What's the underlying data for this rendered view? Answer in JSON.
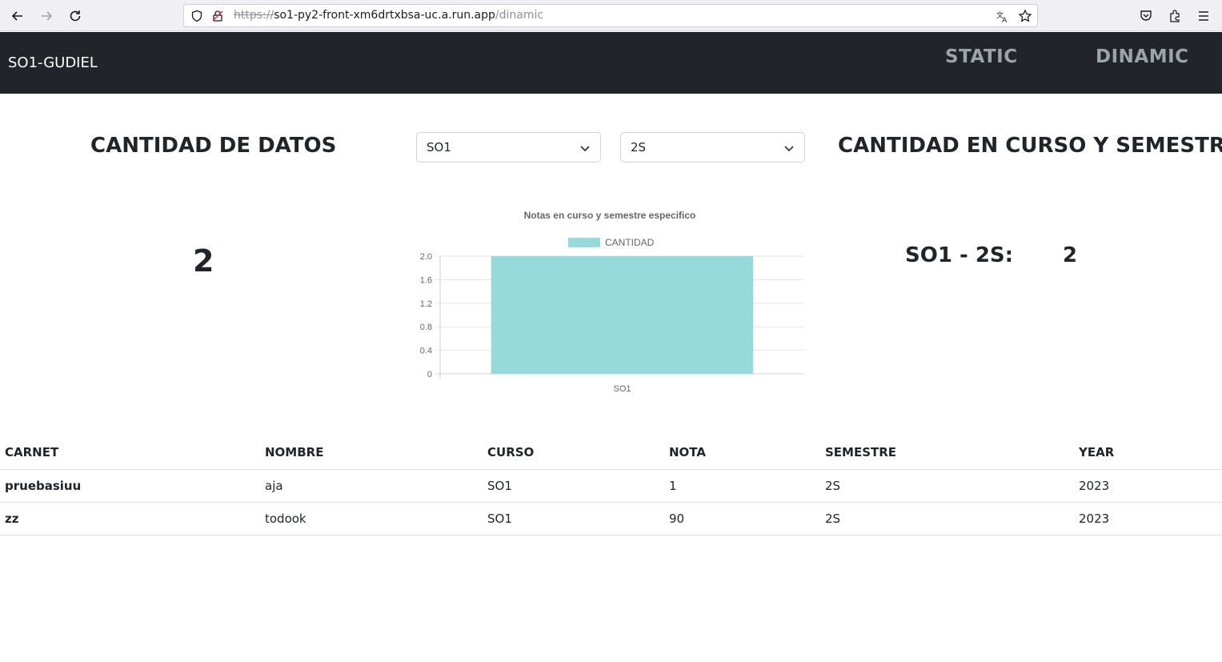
{
  "browser": {
    "url_scheme": "https://",
    "url_host": "so1-py2-front-xm6drtxbsa-uc.a.run.app",
    "url_path": "/dinamic"
  },
  "header": {
    "brand": "SO1-GUDIEL",
    "nav": [
      {
        "label": "STATIC"
      },
      {
        "label": "DINAMIC"
      }
    ]
  },
  "main": {
    "left_heading": "CANTIDAD DE DATOS",
    "right_heading": "CANTIDAD EN CURSO Y SEMESTRE",
    "course_select": "SO1",
    "semester_select": "2S",
    "total_count": "2",
    "summary_label": "SO1 - 2S:",
    "summary_value": "2"
  },
  "chart_data": {
    "type": "bar",
    "title": "Notas en curso y semestre especifico",
    "categories": [
      "SO1"
    ],
    "series": [
      {
        "name": "CANTIDAD",
        "values": [
          2
        ],
        "color": "#96dadb"
      }
    ],
    "ylim": [
      0,
      2.0
    ],
    "yticks": [
      "0",
      "0.4",
      "0.8",
      "1.2",
      "1.6",
      "2.0"
    ],
    "legend_position": "top",
    "grid": true
  },
  "table": {
    "headers": [
      "CARNET",
      "NOMBRE",
      "CURSO",
      "NOTA",
      "SEMESTRE",
      "YEAR"
    ],
    "rows": [
      [
        "pruebasiuu",
        "aja",
        "SO1",
        "1",
        "2S",
        "2023"
      ],
      [
        "zz",
        "todook",
        "SO1",
        "90",
        "2S",
        "2023"
      ]
    ]
  }
}
